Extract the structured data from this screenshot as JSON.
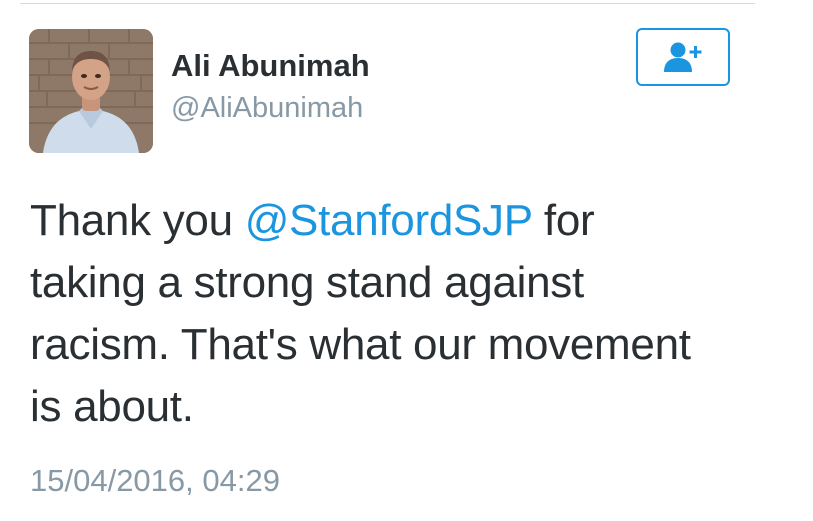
{
  "tweet": {
    "author": {
      "display_name": "Ali Abunimah",
      "handle": "@AliAbunimah"
    },
    "text": {
      "line1_prefix": "Thank you ",
      "mention": "@StanfordSJP",
      "line1_suffix": " for",
      "line2": "taking a strong stand against",
      "line3": "racism. That's what our movement",
      "line4": "is about."
    },
    "timestamp": "15/04/2016, 04:29"
  },
  "icons": {
    "follow": "add-user-icon",
    "avatar": "profile-photo"
  },
  "colors": {
    "accent": "#1b95e0",
    "text_primary": "#292f33",
    "text_secondary": "#8899a6"
  }
}
